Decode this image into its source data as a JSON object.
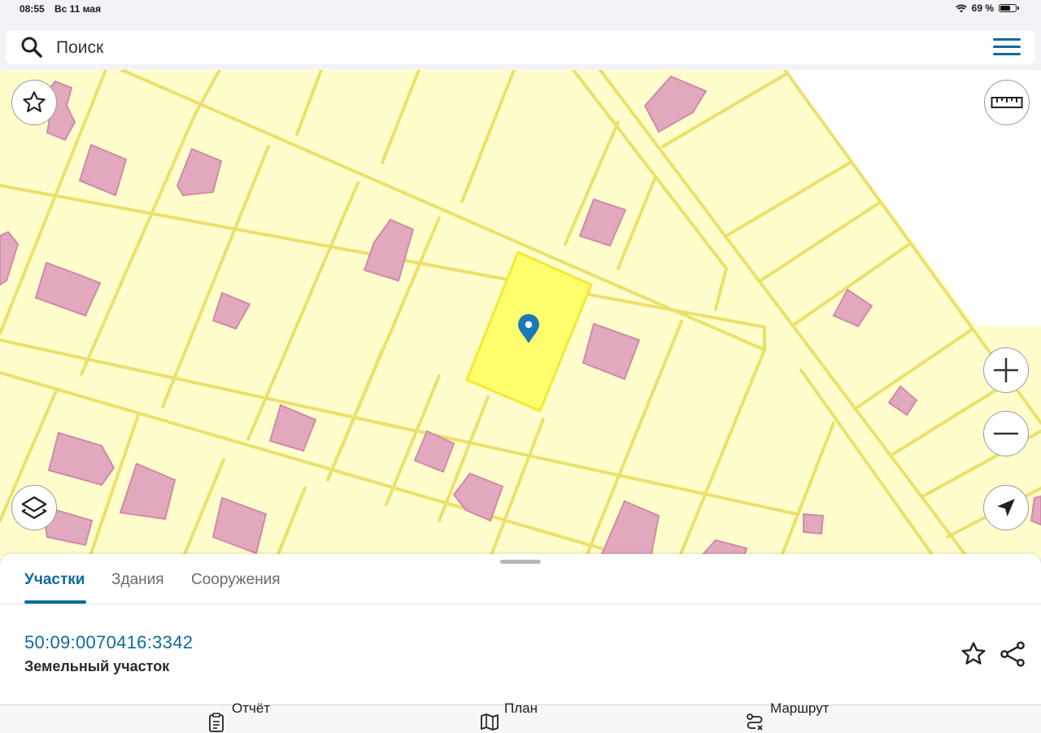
{
  "status_bar": {
    "time": "08:55",
    "date": "Вс 11 мая",
    "battery_text": "69 %",
    "battery_level": 0.69
  },
  "search": {
    "placeholder": "Поиск",
    "icon": "search-icon",
    "menu_icon": "hamburger-menu-icon"
  },
  "map": {
    "selected_parcel_color": "#ffff6e",
    "building_color": "#e2a9be",
    "parcel_border_color": "#ebe06c",
    "marker_color": "#1b79b8",
    "controls": {
      "favorite_icon": "star-icon",
      "layers_icon": "layers-icon",
      "ruler_icon": "ruler-icon",
      "zoom_in_icon": "plus-icon",
      "zoom_out_icon": "minus-icon",
      "locate_icon": "navigation-arrow-icon"
    }
  },
  "sheet": {
    "tabs": [
      {
        "label": "Участки",
        "active": true
      },
      {
        "label": "Здания",
        "active": false
      },
      {
        "label": "Сооружения",
        "active": false
      }
    ],
    "result": {
      "cadastral_number": "50:09:0070416:3342",
      "object_type": "Земельный участок"
    },
    "actions": {
      "favorite_icon": "star-outline-icon",
      "share_icon": "share-icon"
    }
  },
  "bottom_bar": {
    "items": [
      {
        "label": "Отчёт",
        "icon": "report-icon"
      },
      {
        "label": "План",
        "icon": "map-plan-icon"
      },
      {
        "label": "Маршрут",
        "icon": "route-icon"
      }
    ]
  },
  "colors": {
    "accent": "#0e6aa0"
  }
}
